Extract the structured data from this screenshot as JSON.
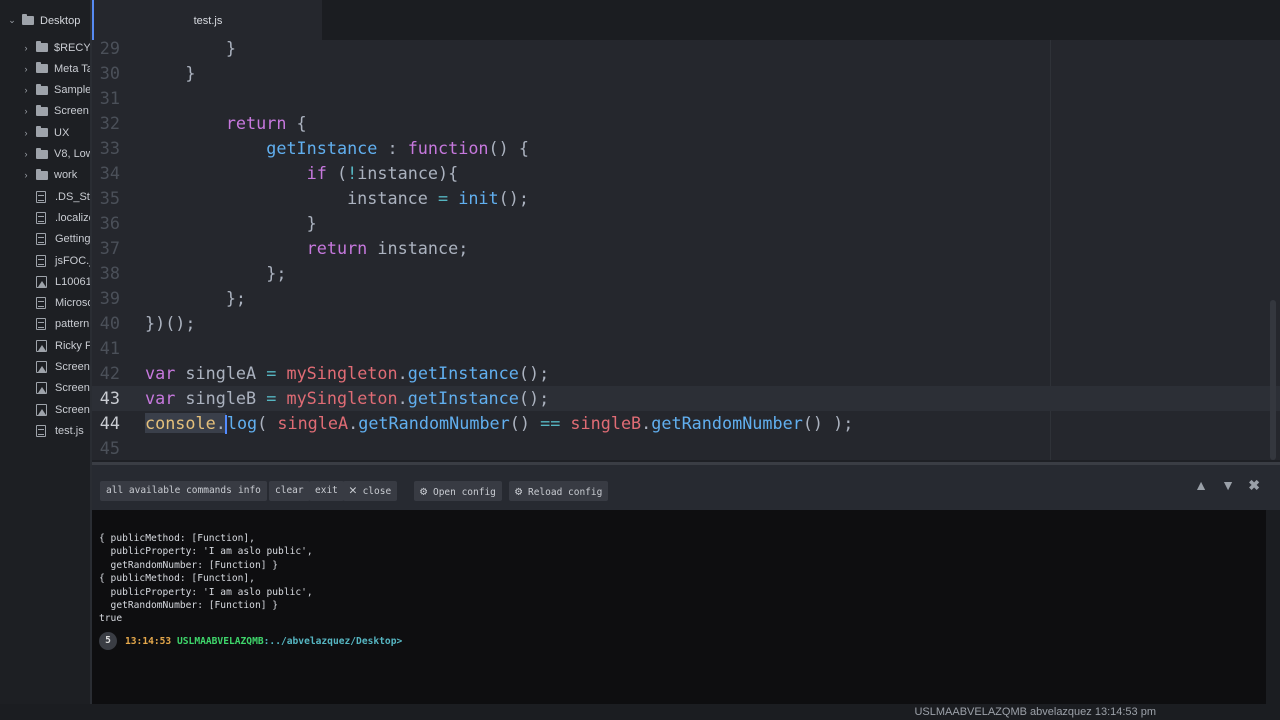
{
  "sidebar": {
    "root": "Desktop",
    "items": [
      {
        "label": "$RECYCLE.BIN",
        "type": "folder"
      },
      {
        "label": "Meta Tags",
        "type": "folder"
      },
      {
        "label": "Sample",
        "type": "folder"
      },
      {
        "label": "Screen",
        "type": "folder"
      },
      {
        "label": "UX",
        "type": "folder"
      },
      {
        "label": "V8, Low",
        "type": "folder"
      },
      {
        "label": "work",
        "type": "folder"
      },
      {
        "label": ".DS_Store",
        "type": "file"
      },
      {
        "label": ".localized",
        "type": "file"
      },
      {
        "label": "Getting",
        "type": "file"
      },
      {
        "label": "jsFOC.js",
        "type": "file"
      },
      {
        "label": "L10061",
        "type": "image"
      },
      {
        "label": "Microsoft",
        "type": "file"
      },
      {
        "label": "pattern",
        "type": "file"
      },
      {
        "label": "Ricky F",
        "type": "image"
      },
      {
        "label": "Screen",
        "type": "image"
      },
      {
        "label": "Screen",
        "type": "image"
      },
      {
        "label": "Screen",
        "type": "image"
      },
      {
        "label": "test.js",
        "type": "file"
      }
    ]
  },
  "tab": {
    "title": "test.js"
  },
  "editor": {
    "current_line": 43,
    "lines": [
      {
        "n": "29",
        "t": [
          [
            "        }",
            "p"
          ]
        ]
      },
      {
        "n": "30",
        "t": [
          [
            "    }",
            "p"
          ]
        ]
      },
      {
        "n": "31",
        "t": []
      },
      {
        "n": "32",
        "t": [
          [
            "        ",
            "p"
          ],
          [
            "return",
            "kw"
          ],
          [
            " {",
            "p"
          ]
        ]
      },
      {
        "n": "33",
        "t": [
          [
            "            ",
            "p"
          ],
          [
            "getInstance",
            "fn"
          ],
          [
            " : ",
            "p"
          ],
          [
            "function",
            "kw"
          ],
          [
            "() {",
            "p"
          ]
        ]
      },
      {
        "n": "34",
        "t": [
          [
            "                ",
            "p"
          ],
          [
            "if",
            "kw"
          ],
          [
            " (",
            "p"
          ],
          [
            "!",
            "op"
          ],
          [
            "instance){",
            "p"
          ]
        ]
      },
      {
        "n": "35",
        "t": [
          [
            "                    instance ",
            "p"
          ],
          [
            "=",
            "op"
          ],
          [
            " ",
            "p"
          ],
          [
            "init",
            "fn"
          ],
          [
            "();",
            "p"
          ]
        ]
      },
      {
        "n": "36",
        "t": [
          [
            "                }",
            "p"
          ]
        ]
      },
      {
        "n": "37",
        "t": [
          [
            "                ",
            "p"
          ],
          [
            "return",
            "kw"
          ],
          [
            " instance;",
            "p"
          ]
        ]
      },
      {
        "n": "38",
        "t": [
          [
            "            };",
            "p"
          ]
        ]
      },
      {
        "n": "39",
        "t": [
          [
            "        };",
            "p"
          ]
        ]
      },
      {
        "n": "40",
        "t": [
          [
            "})();",
            "p"
          ]
        ]
      },
      {
        "n": "41",
        "t": []
      },
      {
        "n": "42",
        "t": [
          [
            "var",
            "kw"
          ],
          [
            " singleA ",
            "p"
          ],
          [
            "=",
            "op"
          ],
          [
            " ",
            "p"
          ],
          [
            "mySingleton",
            "var"
          ],
          [
            ".",
            "p"
          ],
          [
            "getInstance",
            "fn"
          ],
          [
            "();",
            "p"
          ]
        ]
      },
      {
        "n": "43",
        "t": [
          [
            "var",
            "kw"
          ],
          [
            " singleB ",
            "p"
          ],
          [
            "=",
            "op"
          ],
          [
            " ",
            "p"
          ],
          [
            "mySingleton",
            "var"
          ],
          [
            ".",
            "p"
          ],
          [
            "getInstance",
            "fn"
          ],
          [
            "();",
            "p"
          ]
        ]
      },
      {
        "n": "44",
        "t": [
          [
            "console",
            "obj"
          ],
          [
            ".",
            "p"
          ],
          [
            "|",
            "cursor"
          ],
          [
            "log",
            "fn"
          ],
          [
            "( ",
            "p"
          ],
          [
            "singleA",
            "var"
          ],
          [
            ".",
            "p"
          ],
          [
            "getRandomNumber",
            "fn"
          ],
          [
            "() ",
            "p"
          ],
          [
            "==",
            "op"
          ],
          [
            " ",
            "p"
          ],
          [
            "singleB",
            "var"
          ],
          [
            ".",
            "p"
          ],
          [
            "getRandomNumber",
            "fn"
          ],
          [
            "() );",
            "p"
          ]
        ]
      },
      {
        "n": "45",
        "t": []
      }
    ]
  },
  "console": {
    "buttons": [
      "all available commands",
      "info",
      "clear",
      "exit",
      "close",
      "Open config",
      "Reload config"
    ],
    "output": [
      "{ publicMethod: [Function],",
      "  publicProperty: 'I am aslo public',",
      "  getRandomNumber: [Function] }",
      "{ publicMethod: [Function],",
      "  publicProperty: 'I am aslo public',",
      "  getRandomNumber: [Function] }",
      "true"
    ],
    "prompt": {
      "count": "5",
      "time": "13:14:53",
      "host": "USLMAABVELAZQMB",
      "path": ":../abvelazquez/Desktop>"
    },
    "colors": {
      "time": "#e5a84b",
      "host": "#3fd66b",
      "path": "#56b6c2"
    }
  },
  "status": {
    "text": "USLMAABVELAZQMB abvelazquez 13:14:53 pm"
  }
}
